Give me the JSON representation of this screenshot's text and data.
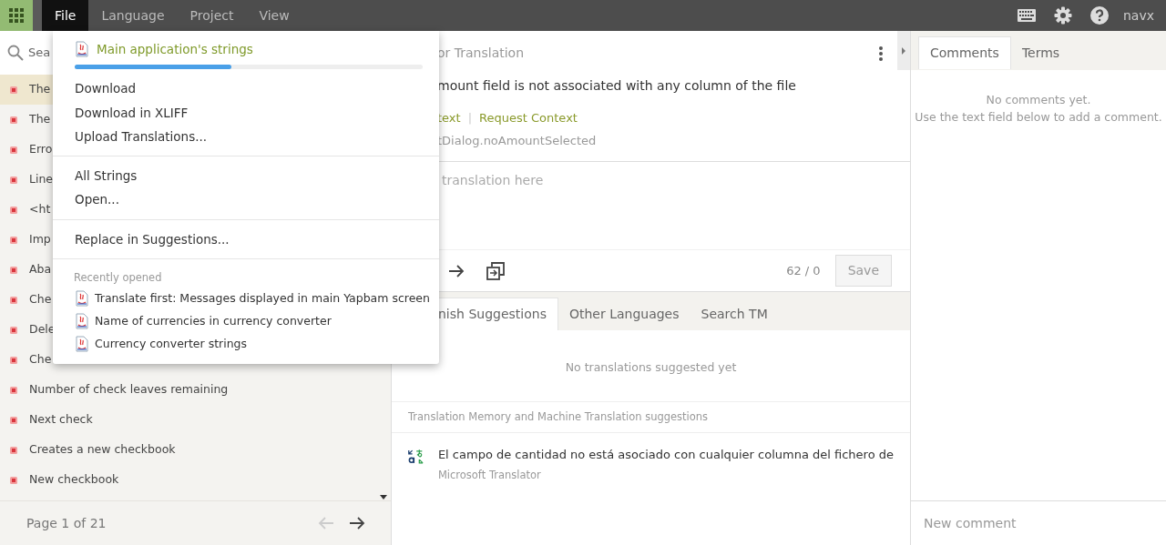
{
  "menubar": {
    "items": [
      {
        "label": "File",
        "selected": true
      },
      {
        "label": "Language",
        "selected": false
      },
      {
        "label": "Project",
        "selected": false
      },
      {
        "label": "View",
        "selected": false
      }
    ],
    "user": "navx"
  },
  "sidebar": {
    "search_placeholder": "Sea",
    "strings": [
      {
        "text": "The",
        "selected": true
      },
      {
        "text": "The",
        "selected": false
      },
      {
        "text": "Erro",
        "selected": false
      },
      {
        "text": "Line",
        "selected": false
      },
      {
        "text": "<ht",
        "selected": false
      },
      {
        "text": "Imp",
        "selected": false
      },
      {
        "text": "Aba",
        "selected": false
      },
      {
        "text": "Che",
        "selected": false
      },
      {
        "text": "Dele",
        "selected": false
      },
      {
        "text": "Che",
        "selected": false
      },
      {
        "text": "Number of check leaves remaining",
        "selected": false
      },
      {
        "text": "Next check",
        "selected": false
      },
      {
        "text": "Creates a new checkbook",
        "selected": false
      },
      {
        "text": "New checkbook",
        "selected": false
      }
    ],
    "page": "Page 1 of 21"
  },
  "editor": {
    "header": "or Translation",
    "source": "mount field is not associated with any column of the file",
    "links": [
      "text",
      "Request Context"
    ],
    "separator": "|",
    "key": "tDialog.noAmountSelected",
    "translation_placeholder": "translation here",
    "counter": "62 / 0",
    "save": {
      "label": "Save",
      "disabled": true
    }
  },
  "suggestions": {
    "tabs": [
      {
        "label": "nish Suggestions",
        "selected": true
      },
      {
        "label": "Other Languages",
        "selected": false
      },
      {
        "label": "Search TM",
        "selected": false
      }
    ],
    "empty": "No translations suggested yet",
    "tm_header": "Translation Memory and Machine Translation suggestions",
    "items": [
      {
        "text": "El campo de cantidad no está asociado con cualquier columna del fichero de",
        "source": "Microsoft Translator"
      }
    ]
  },
  "comments": {
    "tabs": [
      {
        "label": "Comments",
        "selected": true
      },
      {
        "label": "Terms",
        "selected": false
      }
    ],
    "empty": [
      "No comments yet.",
      "Use the text field below to add a comment."
    ],
    "new_comment_placeholder": "New comment"
  },
  "file_menu": {
    "file": {
      "name": "Main application's strings",
      "level": 0.45
    },
    "groups": [
      [
        "Download",
        "Download in XLIFF",
        "Upload Translations..."
      ],
      [
        "All Strings",
        "Open..."
      ],
      [
        "Replace in Suggestions..."
      ]
    ],
    "recent_heading": "Recently opened",
    "recent": [
      "Translate first: Messages displayed in main Yapbam screen",
      "Name of currencies in currency converter",
      "Currency converter strings"
    ]
  }
}
